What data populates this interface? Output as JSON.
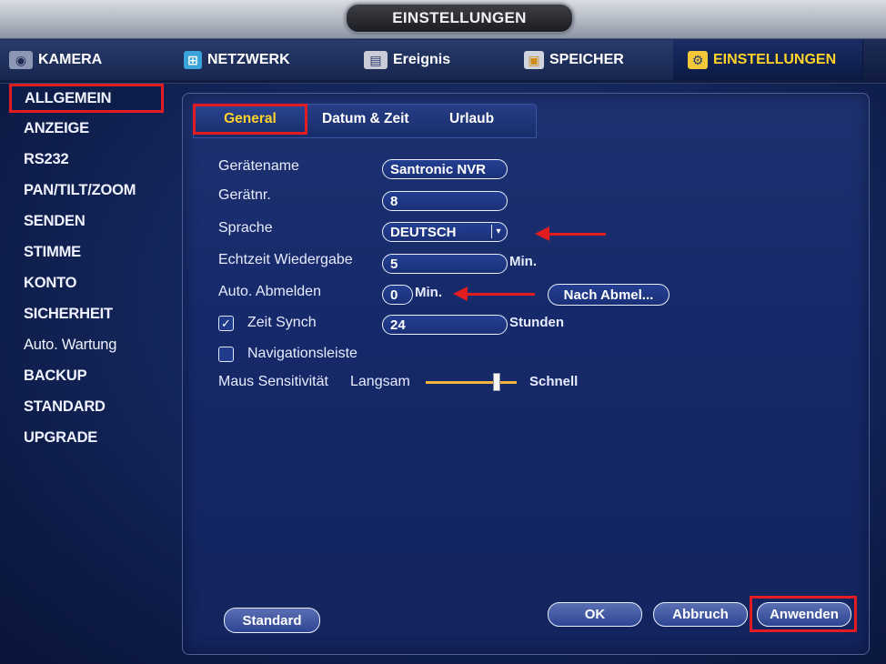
{
  "window": {
    "title": "EINSTELLUNGEN"
  },
  "main_tabs": [
    {
      "label": "KAMERA",
      "icon": "camera-icon",
      "active": false
    },
    {
      "label": "NETZWERK",
      "icon": "network-icon",
      "active": false
    },
    {
      "label": "Ereignis",
      "icon": "event-icon",
      "active": false
    },
    {
      "label": "SPEICHER",
      "icon": "storage-icon",
      "active": false
    },
    {
      "label": "EINSTELLUNGEN",
      "icon": "settings-icon",
      "active": true
    }
  ],
  "sidebar": {
    "items": [
      {
        "label": "ALLGEMEIN",
        "active": true
      },
      {
        "label": "ANZEIGE"
      },
      {
        "label": "RS232"
      },
      {
        "label": "PAN/TILT/ZOOM"
      },
      {
        "label": "SENDEN"
      },
      {
        "label": "STIMME"
      },
      {
        "label": "KONTO"
      },
      {
        "label": "SICHERHEIT"
      },
      {
        "label": "Auto. Wartung"
      },
      {
        "label": "BACKUP"
      },
      {
        "label": "STANDARD"
      },
      {
        "label": "UPGRADE"
      }
    ]
  },
  "sub_tabs": [
    {
      "label": "General",
      "active": true
    },
    {
      "label": "Datum & Zeit"
    },
    {
      "label": "Urlaub"
    }
  ],
  "form": {
    "device_name": {
      "label": "Gerätename",
      "value": "Santronic NVR"
    },
    "device_no": {
      "label": "Gerätnr.",
      "value": "8"
    },
    "language": {
      "label": "Sprache",
      "value": "DEUTSCH"
    },
    "realtime_playback": {
      "label": "Echtzeit Wiedergabe",
      "value": "5",
      "unit": "Min."
    },
    "auto_logout": {
      "label": "Auto. Abmelden",
      "value": "0",
      "unit": "Min.",
      "button": "Nach Abmel..."
    },
    "time_sync": {
      "label": "Zeit Synch",
      "checked": true,
      "value": "24",
      "unit": "Stunden"
    },
    "nav_bar": {
      "label": "Navigationsleiste",
      "checked": false
    },
    "mouse_sensitivity": {
      "label": "Maus Sensitivität",
      "min_label": "Langsam",
      "max_label": "Schnell",
      "level": 0.78
    }
  },
  "buttons": {
    "standard": "Standard",
    "ok": "OK",
    "cancel": "Abbruch",
    "apply": "Anwenden"
  },
  "colors": {
    "highlight": "#e31b23",
    "active_tab_text": "#ffd32a",
    "slider_fill": "#f2b33a"
  }
}
